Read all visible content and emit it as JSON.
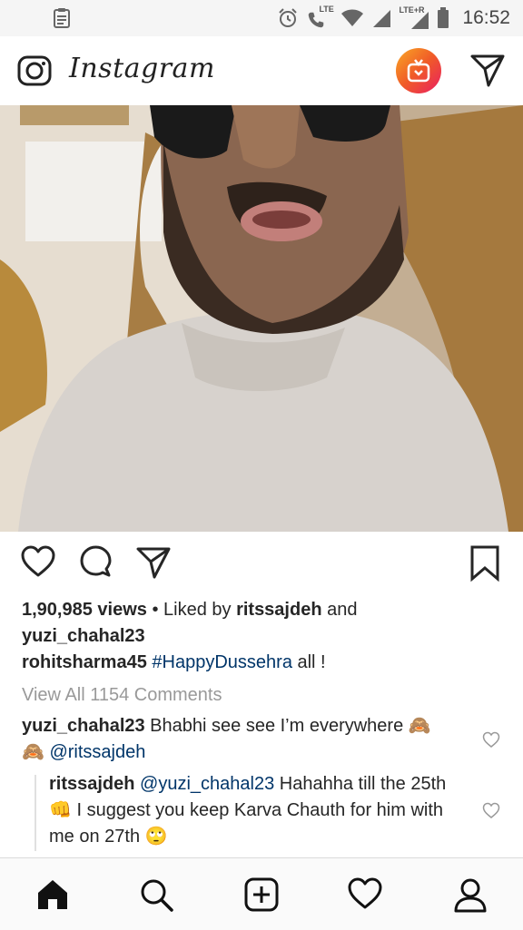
{
  "status_bar": {
    "time": "16:52",
    "lte_label": "LTE",
    "lte_r_label": "LTE+R"
  },
  "header": {
    "app_name": "Instagram"
  },
  "post": {
    "views_count": "1,90,985 views",
    "liked_by_prefix": " • Liked by ",
    "liked_by_user1": "ritssajdeh",
    "liked_by_and": " and",
    "liked_by_user2": "yuzi_chahal23",
    "caption_user": "rohitsharma45",
    "caption_hashtag": "#HappyDussehra",
    "caption_rest": " all !",
    "view_all_comments": "View All 1154 Comments"
  },
  "comments": [
    {
      "user": "yuzi_chahal23",
      "text": " Bhabhi see see I’m everywhere 🙈",
      "text2": "🙈 ",
      "mention": "@ritssajdeh"
    },
    {
      "user": "ritssajdeh",
      "mention": "@yuzi_chahal23",
      "text": " Hahahha till the 25th 👊 I suggest you keep Karva Chauth for him with me on 27th 🙄"
    }
  ],
  "colors": {
    "accent_link": "#003569",
    "muted_text": "#999999",
    "igtv_gradient_start": "#f9a825",
    "igtv_gradient_end": "#e91e63"
  },
  "icons": {
    "status_left": "clipboard-icon",
    "alarm": "alarm-icon",
    "call": "call-lte-icon",
    "wifi": "wifi-icon",
    "signal": "signal-icon",
    "battery": "battery-icon",
    "camera": "camera-icon",
    "igtv": "igtv-icon",
    "direct": "direct-send-icon",
    "like": "heart-icon",
    "comment": "comment-icon",
    "share": "share-icon",
    "save": "bookmark-icon",
    "nav_home": "home-icon",
    "nav_search": "search-icon",
    "nav_add": "add-post-icon",
    "nav_activity": "heart-icon",
    "nav_profile": "profile-icon"
  }
}
